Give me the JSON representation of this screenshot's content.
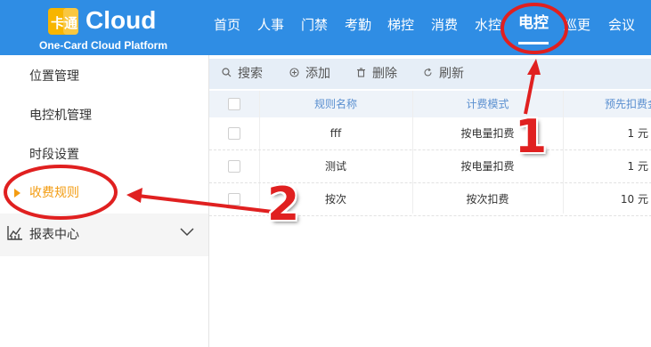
{
  "header": {
    "logo_mark": "卡通",
    "logo_text": "Cloud",
    "logo_subtitle": "One-Card Cloud Platform",
    "nav": [
      {
        "label": "首页",
        "active": false
      },
      {
        "label": "人事",
        "active": false
      },
      {
        "label": "门禁",
        "active": false
      },
      {
        "label": "考勤",
        "active": false
      },
      {
        "label": "梯控",
        "active": false
      },
      {
        "label": "消费",
        "active": false
      },
      {
        "label": "水控",
        "active": false
      },
      {
        "label": "电控",
        "active": true
      },
      {
        "label": "巡更",
        "active": false
      },
      {
        "label": "会议",
        "active": false
      }
    ]
  },
  "sidebar": {
    "items": [
      {
        "label": "位置管理",
        "active": false
      },
      {
        "label": "电控机管理",
        "active": false
      },
      {
        "label": "时段设置",
        "active": false
      },
      {
        "label": "收费规则",
        "active": true
      }
    ],
    "group": {
      "label": "报表中心",
      "icon": "chart-icon",
      "expanded": false
    }
  },
  "toolbar": {
    "search_label": "搜索",
    "add_label": "添加",
    "delete_label": "删除",
    "refresh_label": "刷新"
  },
  "table": {
    "columns": [
      "规则名称",
      "计费模式",
      "预先扣费金"
    ],
    "rows": [
      {
        "name": "fff",
        "mode": "按电量扣费",
        "prepay": "1 元"
      },
      {
        "name": "测试",
        "mode": "按电量扣费",
        "prepay": "1 元"
      },
      {
        "name": "按次",
        "mode": "按次扣费",
        "prepay": "10 元"
      }
    ]
  },
  "annotations": {
    "marker_1": "1",
    "marker_2": "2",
    "color": "#e02020"
  },
  "colors": {
    "header_bg": "#2f8de4",
    "accent_active": "#f39c12",
    "toolbar_bg": "#e6eef7",
    "table_header_text": "#5a8fd0"
  }
}
